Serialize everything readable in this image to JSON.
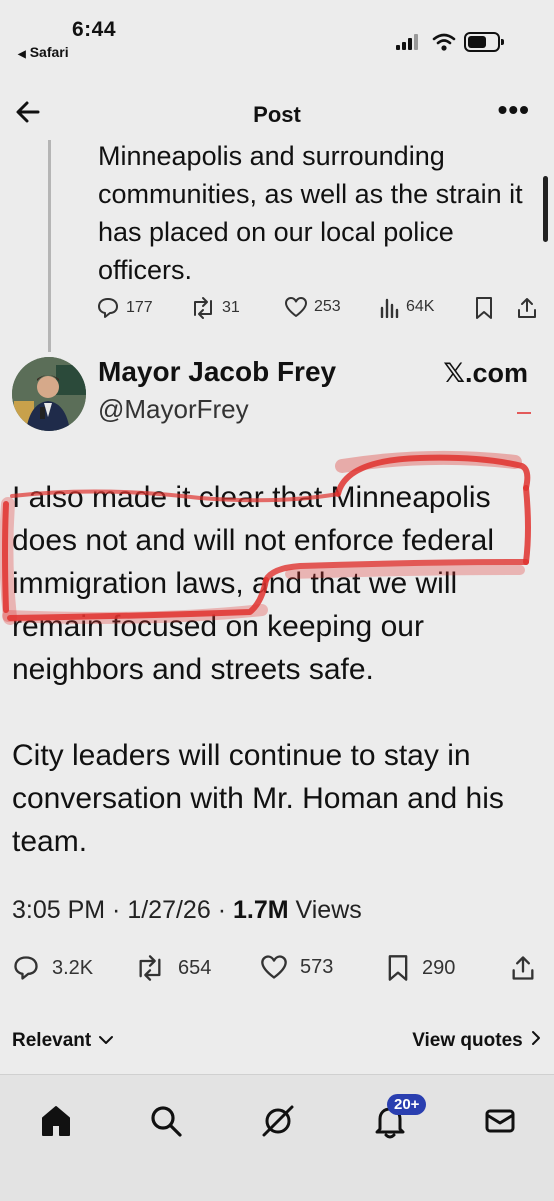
{
  "status_bar": {
    "time": "6:44",
    "back_app": "Safari"
  },
  "nav": {
    "title": "Post"
  },
  "previous_post": {
    "text": "Minneapolis and surrounding communities, as well as the strain it has placed on our local police officers.",
    "replies": "177",
    "reposts": "31",
    "likes": "253",
    "views": "64K"
  },
  "author": {
    "name": "Mayor Jacob Frey",
    "handle": "@MayorFrey",
    "badge_x": "𝕏",
    "badge_domain": ".com"
  },
  "tweet": {
    "paragraph1": "I also made it clear that Minneapolis does not and will not enforce federal immigration laws, and that we will remain focused on keeping our neighbors and streets safe.",
    "paragraph2": "City leaders will continue to stay in conversation with Mr. Homan and his team."
  },
  "meta": {
    "time": "3:05 PM",
    "sep1": " · ",
    "date": "1/27/26",
    "sep2": " · ",
    "views_count": "1.7M",
    "views_label": " Views"
  },
  "actions": {
    "replies": "3.2K",
    "reposts": "654",
    "likes": "573",
    "bookmarks": "290"
  },
  "filter": {
    "relevant": "Relevant",
    "view_quotes": "View quotes"
  },
  "tabbar": {
    "notifications_badge": "20+"
  },
  "colors": {
    "highlight": "#e0332f",
    "badge": "#2a3fb0",
    "background": "#ececec"
  }
}
